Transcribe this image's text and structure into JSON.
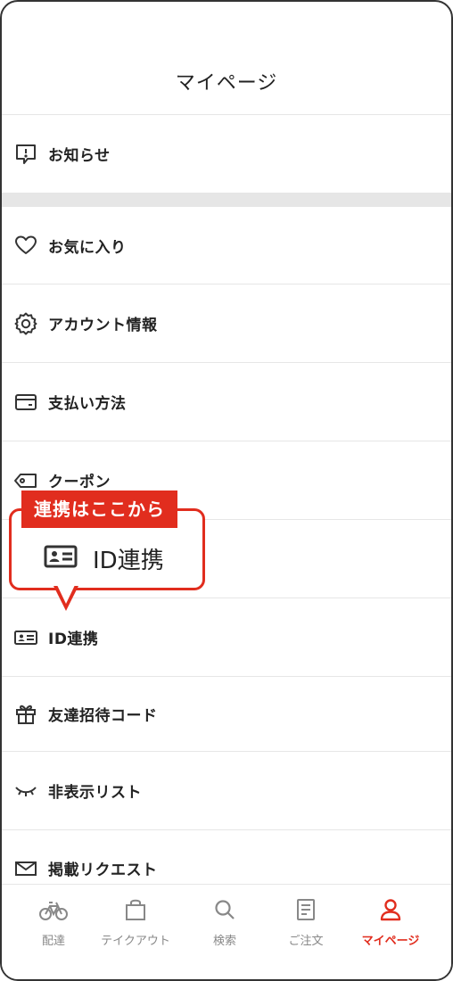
{
  "header": {
    "title": "マイページ"
  },
  "menu": [
    {
      "label": "お知らせ",
      "icon": "notification-icon"
    },
    {
      "label": "お気に入り",
      "icon": "heart-icon"
    },
    {
      "label": "アカウント情報",
      "icon": "gear-icon"
    },
    {
      "label": "支払い方法",
      "icon": "credit-card-icon"
    },
    {
      "label": "クーポン",
      "icon": "coupon-tag-icon"
    },
    {
      "label": "ID連携",
      "icon": "id-card-icon"
    },
    {
      "label": "友達招待コード",
      "icon": "gift-icon"
    },
    {
      "label": "非表示リスト",
      "icon": "closed-eye-icon"
    },
    {
      "label": "掲載リクエスト",
      "icon": "envelope-icon"
    }
  ],
  "callout": {
    "tag": "連携はここから",
    "label": "ID連携",
    "icon": "id-card-icon"
  },
  "nav": [
    {
      "label": "配達",
      "icon": "bicycle-icon"
    },
    {
      "label": "テイクアウト",
      "icon": "shopping-bag-icon"
    },
    {
      "label": "検索",
      "icon": "search-icon"
    },
    {
      "label": "ご注文",
      "icon": "order-list-icon"
    },
    {
      "label": "マイページ",
      "icon": "user-icon",
      "active": true
    }
  ],
  "colors": {
    "accent": "#e12d1e",
    "divider": "#e6e6e6",
    "text": "#222222",
    "muted": "#888888"
  }
}
